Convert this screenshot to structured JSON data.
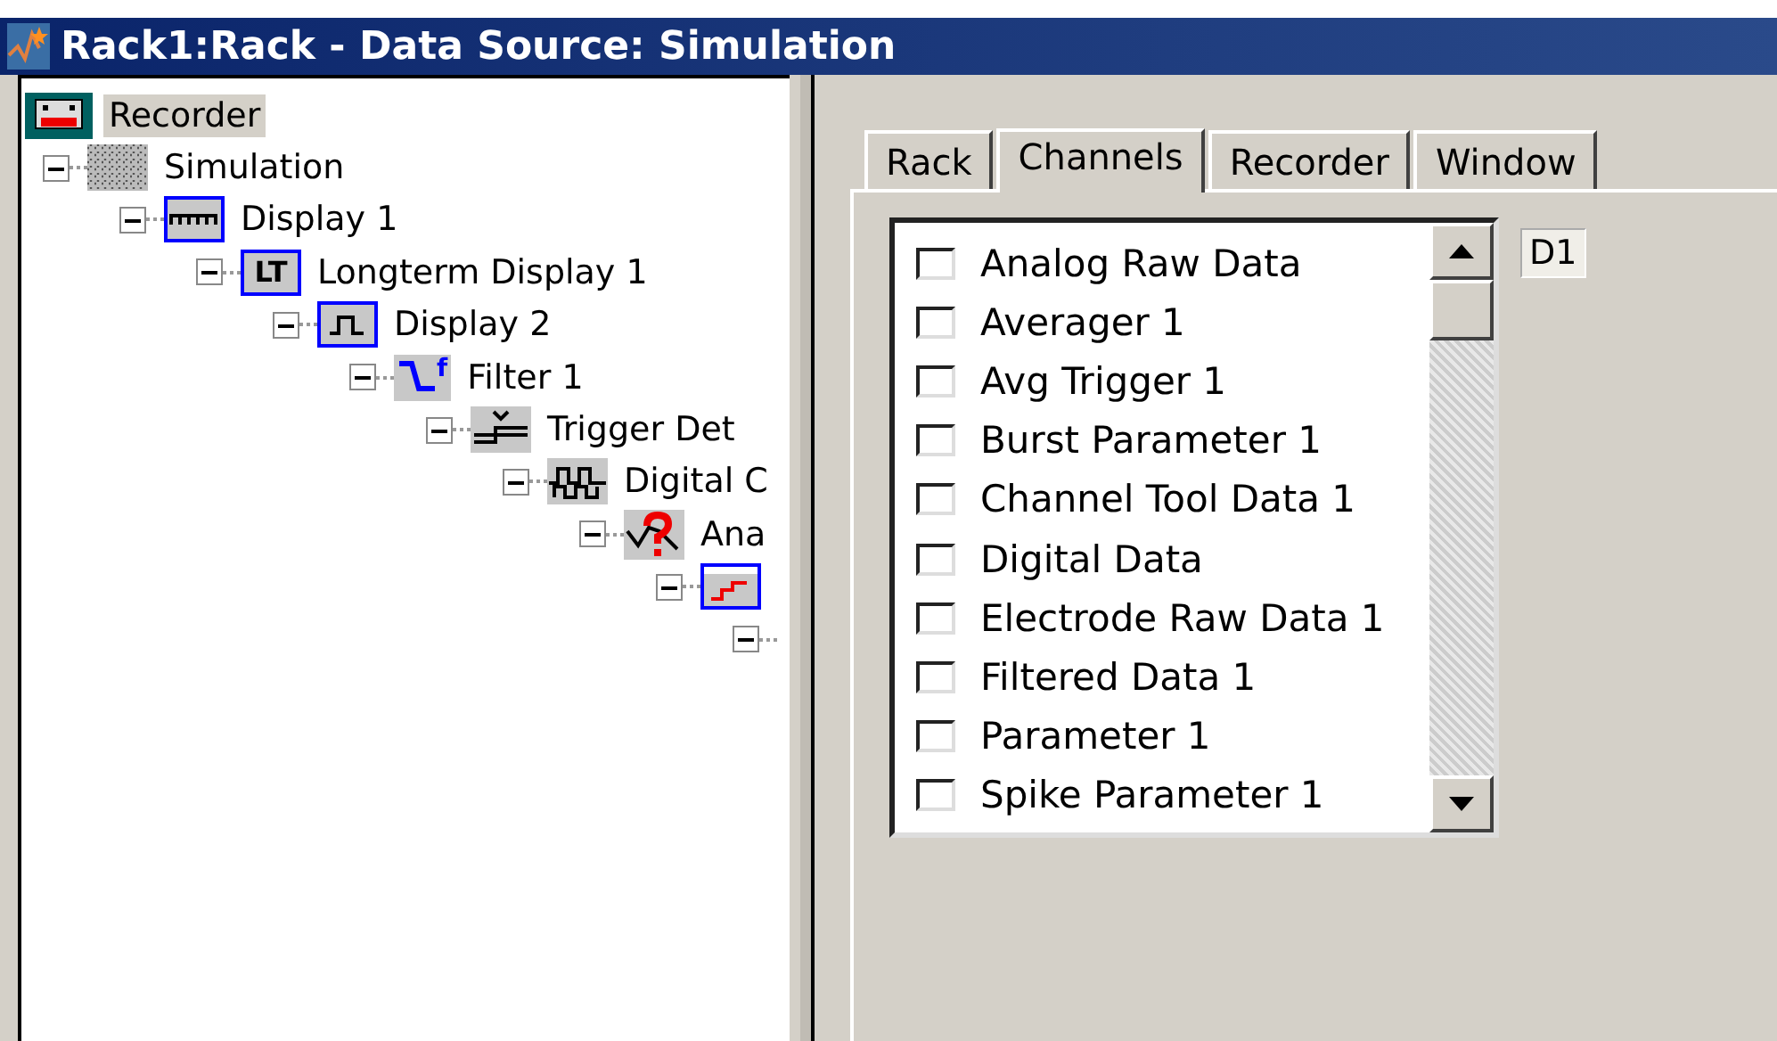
{
  "window": {
    "title": "Rack1:Rack - Data Source: Simulation"
  },
  "tree": [
    {
      "label": "Recorder",
      "kind": "recorder",
      "selected": true,
      "children": [
        {
          "label": "Simulation",
          "kind": "grid",
          "expanded": true,
          "selected": false,
          "children": [
            {
              "label": "Display 1",
              "kind": "wave",
              "expanded": true,
              "selected": false,
              "children": [
                {
                  "label": "Longterm Display 1",
                  "kind": "lt",
                  "icon_label": "LT",
                  "expanded": true,
                  "selected": false,
                  "children": [
                    {
                      "label": "Display 2",
                      "kind": "pulse",
                      "expanded": true,
                      "selected": false,
                      "children": [
                        {
                          "label": "Filter 1",
                          "kind": "filter",
                          "icon_label": "f",
                          "expanded": true,
                          "selected": false,
                          "children": [
                            {
                              "label": "Trigger Det",
                              "kind": "trigger",
                              "expanded": true,
                              "selected": false,
                              "children": [
                                {
                                  "label": "Digital C",
                                  "kind": "digital",
                                  "expanded": true,
                                  "selected": false,
                                  "children": [
                                    {
                                      "label": "Ana",
                                      "kind": "analyzer",
                                      "expanded": true,
                                      "selected": false,
                                      "children": [
                                        {
                                          "kind": "step",
                                          "expanded": true,
                                          "selected": false,
                                          "children": [
                                            {
                                              "expanded": true,
                                              "selected": false
                                            }
                                          ]
                                        }
                                      ]
                                    }
                                  ]
                                }
                              ]
                            }
                          ]
                        }
                      ]
                    }
                  ]
                }
              ]
            }
          ]
        }
      ]
    }
  ],
  "tabs": [
    {
      "label": "Rack",
      "selected": false
    },
    {
      "label": "Channels",
      "selected": true
    },
    {
      "label": "Recorder",
      "selected": false
    },
    {
      "label": "Window",
      "selected": false
    }
  ],
  "channels": [
    {
      "label": "Analog Raw Data",
      "checked": false
    },
    {
      "label": "Averager 1",
      "checked": false
    },
    {
      "label": "Avg Trigger 1",
      "checked": false
    },
    {
      "label": "Burst Parameter 1",
      "checked": false
    },
    {
      "label": "Channel Tool Data 1",
      "checked": false
    },
    {
      "label": "Digital Data",
      "checked": false
    },
    {
      "label": "Electrode Raw Data 1",
      "checked": false
    },
    {
      "label": "Filtered Data 1",
      "checked": false
    },
    {
      "label": "Parameter 1",
      "checked": false
    },
    {
      "label": "Spike Parameter 1",
      "checked": false
    }
  ],
  "field": {
    "value": "D1"
  }
}
